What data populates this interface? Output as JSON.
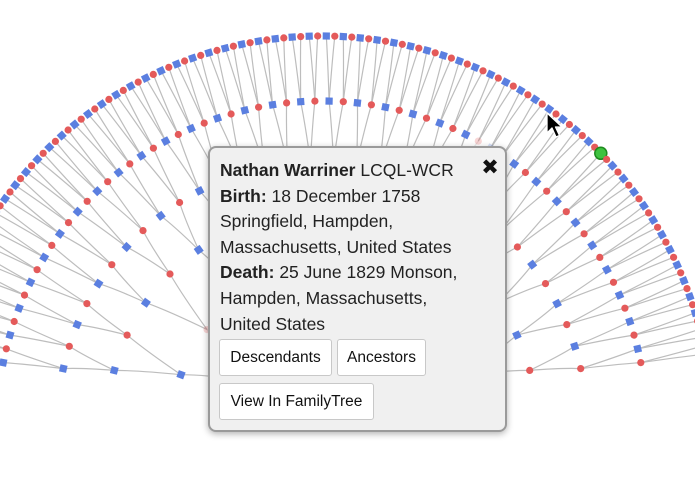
{
  "person": {
    "name": "Nathan Warriner",
    "id": "LCQL-WCR",
    "birth_label": "Birth:",
    "birth_date": "18 December 1758",
    "birth_place": "Springfield, Hampden, Massachusetts, United States",
    "death_label": "Death:",
    "death_date": "25 June 1829",
    "death_place": "Monson, Hampden, Massachusetts, United States"
  },
  "actions": {
    "close_icon": "✖",
    "descendants_label": "Descendants",
    "ancestors_label": "Ancestors",
    "view_tree_label": "View In FamilyTree"
  },
  "icons": {
    "close": "close-icon",
    "cursor": "mouse-pointer-icon"
  },
  "colors": {
    "male": "#5b7fe0",
    "female": "#e45a5a",
    "selected": "#3fc23f",
    "link": "#bdbdbd",
    "popup_bg": "#f0f0f0",
    "popup_border": "#9a9a9a"
  }
}
